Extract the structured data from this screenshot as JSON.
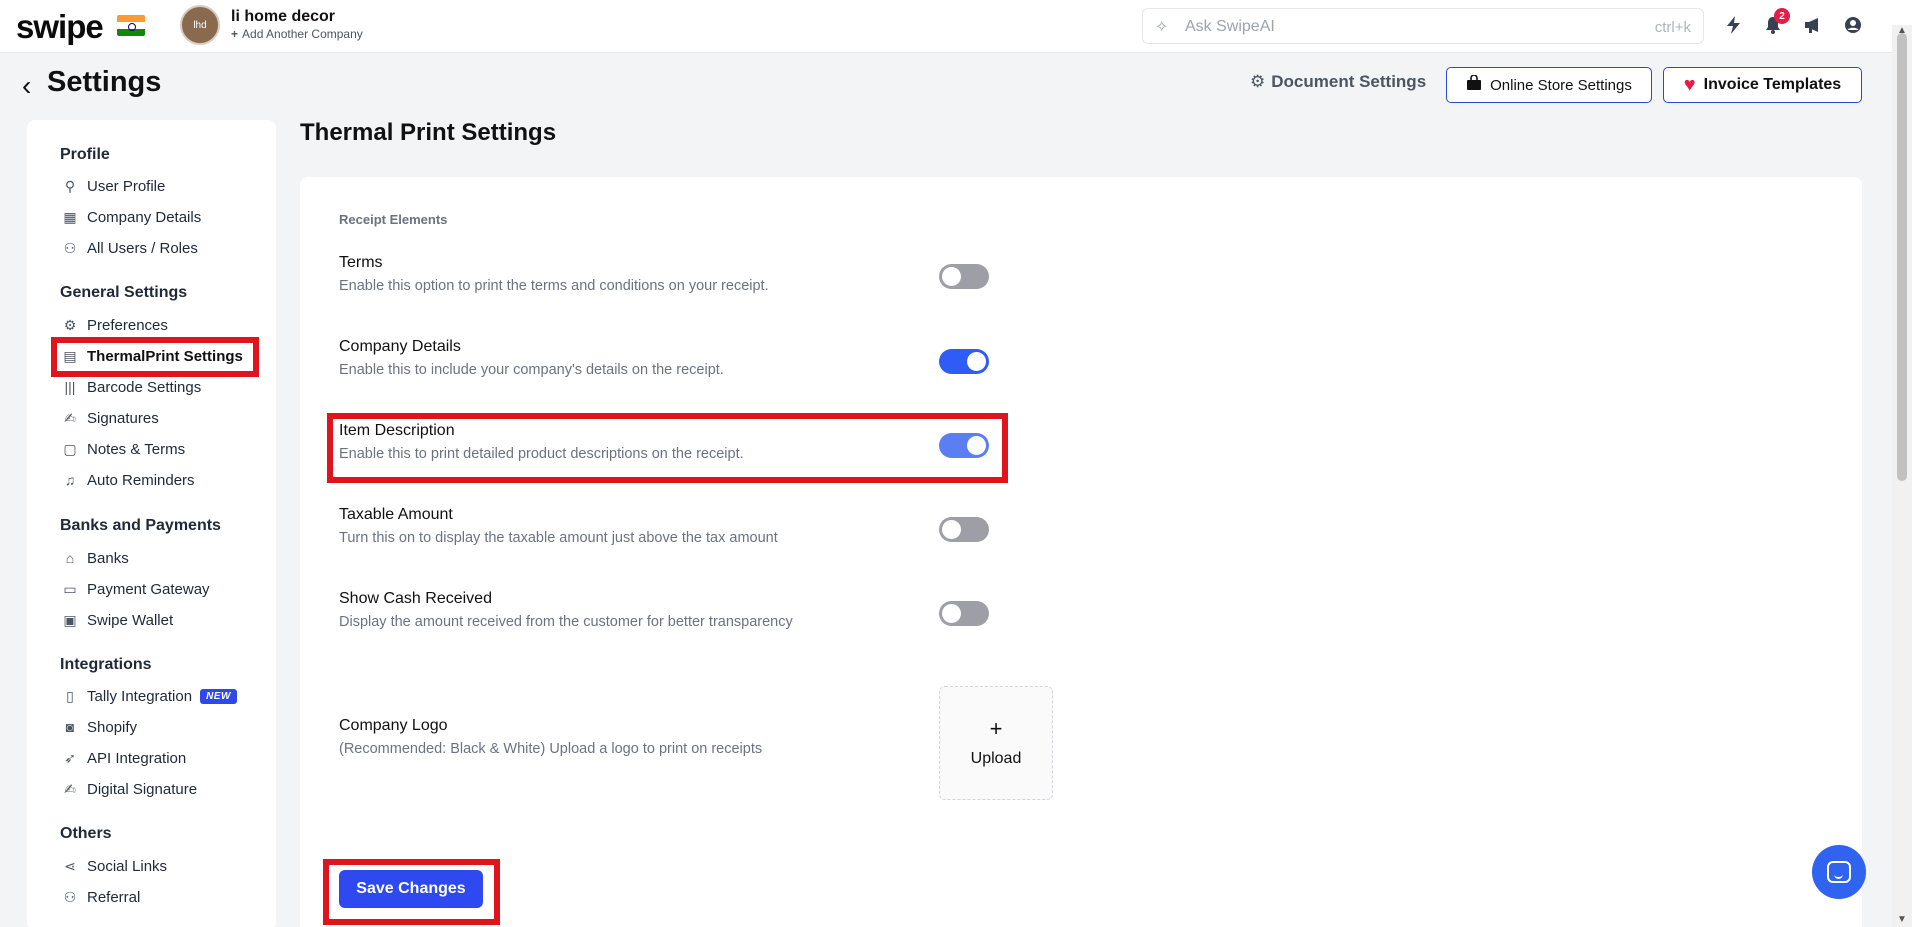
{
  "brand": {
    "logo_text": "swipe"
  },
  "company": {
    "avatar_text": "lhd",
    "name": "li home decor",
    "add_label": "Add Another Company"
  },
  "ai_search": {
    "placeholder": "Ask SwipeAI",
    "shortcut": "ctrl+k"
  },
  "top_icons": {
    "lightning": "lightning-icon",
    "bell": "bell-icon",
    "megaphone": "megaphone-icon",
    "user": "user-circle-icon",
    "notif_count": "2"
  },
  "header": {
    "title": "Settings",
    "document_settings": "Document Settings",
    "online_store_settings": "Online Store Settings",
    "invoice_templates": "Invoice Templates"
  },
  "sidebar": {
    "sections": [
      {
        "title": "Profile",
        "items": [
          "User Profile",
          "Company Details",
          "All Users / Roles"
        ]
      },
      {
        "title": "General Settings",
        "items": [
          "Preferences",
          "ThermalPrint Settings",
          "Barcode Settings",
          "Signatures",
          "Notes & Terms",
          "Auto Reminders"
        ]
      },
      {
        "title": "Banks and Payments",
        "items": [
          "Banks",
          "Payment Gateway",
          "Swipe Wallet"
        ]
      },
      {
        "title": "Integrations",
        "items": [
          "Tally Integration",
          "Shopify",
          "API Integration",
          "Digital Signature"
        ],
        "new_badge": "NEW"
      },
      {
        "title": "Others",
        "items": [
          "Social Links",
          "Referral"
        ]
      }
    ]
  },
  "content": {
    "title": "Thermal Print Settings",
    "group_label": "Receipt Elements",
    "settings": [
      {
        "title": "Terms",
        "description": "Enable this option to print the terms and conditions on your receipt.",
        "enabled": false
      },
      {
        "title": "Company Details",
        "description": "Enable this to include your company's details on the receipt.",
        "enabled": true
      },
      {
        "title": "Item Description",
        "description": "Enable this to print detailed product descriptions on the receipt.",
        "enabled": true
      },
      {
        "title": "Taxable Amount",
        "description": "Turn this on to display the taxable amount just above the tax amount",
        "enabled": false
      },
      {
        "title": "Show Cash Received",
        "description": "Display the amount received from the customer for better transparency",
        "enabled": false
      }
    ],
    "logo": {
      "title": "Company Logo",
      "description": "(Recommended: Black & White) Upload a logo to print on receipts",
      "upload_plus": "+",
      "upload_label": "Upload"
    },
    "save_label": "Save Changes"
  },
  "colors": {
    "primary": "#2f49f0",
    "highlight": "#e0141c",
    "toggle_on": "#2f5cf6",
    "toggle_off": "#9e9ea6"
  }
}
